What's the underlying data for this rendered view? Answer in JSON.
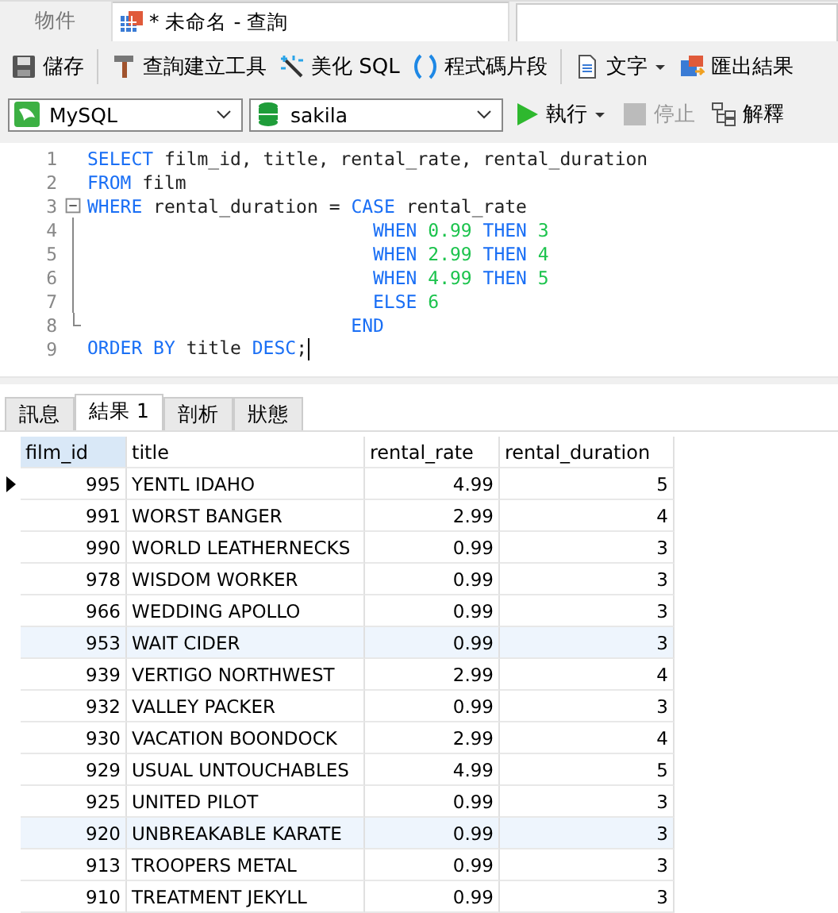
{
  "tabs": [
    {
      "label": "物件",
      "selected": false,
      "kind": "plain"
    },
    {
      "label": "* 未命名 - 查詢",
      "selected": true,
      "kind": "query"
    }
  ],
  "toolbar": [
    {
      "label": "儲存",
      "kind": "save"
    },
    {
      "label": "查詢建立工具",
      "kind": "builder"
    },
    {
      "label": "美化 SQL",
      "kind": "beautify"
    },
    {
      "label": "程式碼片段",
      "kind": "snippet"
    },
    {
      "label": "文字",
      "kind": "text"
    },
    {
      "label": "匯出結果",
      "kind": "export"
    }
  ],
  "connection": {
    "value": "MySQL"
  },
  "database": {
    "value": "sakila"
  },
  "run_buttons": [
    {
      "label": "執行",
      "kind": "run",
      "disabled": false
    },
    {
      "label": "停止",
      "kind": "stop",
      "disabled": true
    },
    {
      "label": "解釋",
      "kind": "explain",
      "disabled": false
    }
  ],
  "editor": {
    "lines": [
      {
        "number": "1",
        "kind": "plain",
        "cursor": false,
        "tokens": [
          {
            "kind": "kw",
            "text": "SELECT"
          },
          {
            "kind": "plain",
            "text": " film_id, title, rental_rate, rental_duration"
          }
        ]
      },
      {
        "number": "2",
        "kind": "plain",
        "cursor": false,
        "tokens": [
          {
            "kind": "kw",
            "text": "FROM"
          },
          {
            "kind": "plain",
            "text": " film"
          }
        ]
      },
      {
        "number": "3",
        "kind": "fold-start",
        "cursor": false,
        "tokens": [
          {
            "kind": "kw",
            "text": "WHERE"
          },
          {
            "kind": "plain",
            "text": " rental_duration = "
          },
          {
            "kind": "kw",
            "text": "CASE"
          },
          {
            "kind": "plain",
            "text": " rental_rate"
          }
        ]
      },
      {
        "number": "4",
        "kind": "fold-body",
        "cursor": false,
        "tokens": [
          {
            "kind": "kw",
            "text": "                          WHEN"
          },
          {
            "kind": "num",
            "text": " 0.99"
          },
          {
            "kind": "kw",
            "text": " THEN"
          },
          {
            "kind": "num",
            "text": " 3"
          }
        ]
      },
      {
        "number": "5",
        "kind": "fold-body",
        "cursor": false,
        "tokens": [
          {
            "kind": "kw",
            "text": "                          WHEN"
          },
          {
            "kind": "num",
            "text": " 2.99"
          },
          {
            "kind": "kw",
            "text": " THEN"
          },
          {
            "kind": "num",
            "text": " 4"
          }
        ]
      },
      {
        "number": "6",
        "kind": "fold-body",
        "cursor": false,
        "tokens": [
          {
            "kind": "kw",
            "text": "                          WHEN"
          },
          {
            "kind": "num",
            "text": " 4.99"
          },
          {
            "kind": "kw",
            "text": " THEN"
          },
          {
            "kind": "num",
            "text": " 5"
          }
        ]
      },
      {
        "number": "7",
        "kind": "fold-body",
        "cursor": false,
        "tokens": [
          {
            "kind": "kw",
            "text": "                          ELSE"
          },
          {
            "kind": "num",
            "text": " 6"
          }
        ]
      },
      {
        "number": "8",
        "kind": "fold-end",
        "cursor": false,
        "tokens": [
          {
            "kind": "kw",
            "text": "                        END"
          }
        ]
      },
      {
        "number": "9",
        "kind": "plain",
        "cursor": true,
        "tokens": [
          {
            "kind": "kw",
            "text": "ORDER BY"
          },
          {
            "kind": "plain",
            "text": " title "
          },
          {
            "kind": "kw",
            "text": "DESC"
          },
          {
            "kind": "plain",
            "text": ";"
          }
        ]
      }
    ]
  },
  "result_tabs": [
    {
      "label": "訊息",
      "selected": false
    },
    {
      "label": "結果 1",
      "selected": true
    },
    {
      "label": "剖析",
      "selected": false
    },
    {
      "label": "狀態",
      "selected": false
    }
  ],
  "table": {
    "columns": [
      {
        "label": "film_id",
        "selected": true,
        "kind": "number"
      },
      {
        "label": "title",
        "selected": false,
        "kind": "text"
      },
      {
        "label": "rental_rate",
        "selected": false,
        "kind": "number"
      },
      {
        "label": "rental_duration",
        "selected": false,
        "kind": "number"
      }
    ],
    "rows": [
      {
        "selected": true,
        "shaded": false,
        "cells": [
          "995",
          "YENTL IDAHO",
          "4.99",
          "5"
        ]
      },
      {
        "selected": false,
        "shaded": false,
        "cells": [
          "991",
          "WORST BANGER",
          "2.99",
          "4"
        ]
      },
      {
        "selected": false,
        "shaded": false,
        "cells": [
          "990",
          "WORLD LEATHERNECKS",
          "0.99",
          "3"
        ]
      },
      {
        "selected": false,
        "shaded": false,
        "cells": [
          "978",
          "WISDOM WORKER",
          "0.99",
          "3"
        ]
      },
      {
        "selected": false,
        "shaded": false,
        "cells": [
          "966",
          "WEDDING APOLLO",
          "0.99",
          "3"
        ]
      },
      {
        "selected": false,
        "shaded": true,
        "cells": [
          "953",
          "WAIT CIDER",
          "0.99",
          "3"
        ]
      },
      {
        "selected": false,
        "shaded": false,
        "cells": [
          "939",
          "VERTIGO NORTHWEST",
          "2.99",
          "4"
        ]
      },
      {
        "selected": false,
        "shaded": false,
        "cells": [
          "932",
          "VALLEY PACKER",
          "0.99",
          "3"
        ]
      },
      {
        "selected": false,
        "shaded": false,
        "cells": [
          "930",
          "VACATION BOONDOCK",
          "2.99",
          "4"
        ]
      },
      {
        "selected": false,
        "shaded": false,
        "cells": [
          "929",
          "USUAL UNTOUCHABLES",
          "4.99",
          "5"
        ]
      },
      {
        "selected": false,
        "shaded": false,
        "cells": [
          "925",
          "UNITED PILOT",
          "0.99",
          "3"
        ]
      },
      {
        "selected": false,
        "shaded": true,
        "cells": [
          "920",
          "UNBREAKABLE KARATE",
          "0.99",
          "3"
        ]
      },
      {
        "selected": false,
        "shaded": false,
        "cells": [
          "913",
          "TROOPERS METAL",
          "0.99",
          "3"
        ]
      },
      {
        "selected": false,
        "shaded": false,
        "cells": [
          "910",
          "TREATMENT JEKYLL",
          "0.99",
          "3"
        ]
      }
    ]
  }
}
